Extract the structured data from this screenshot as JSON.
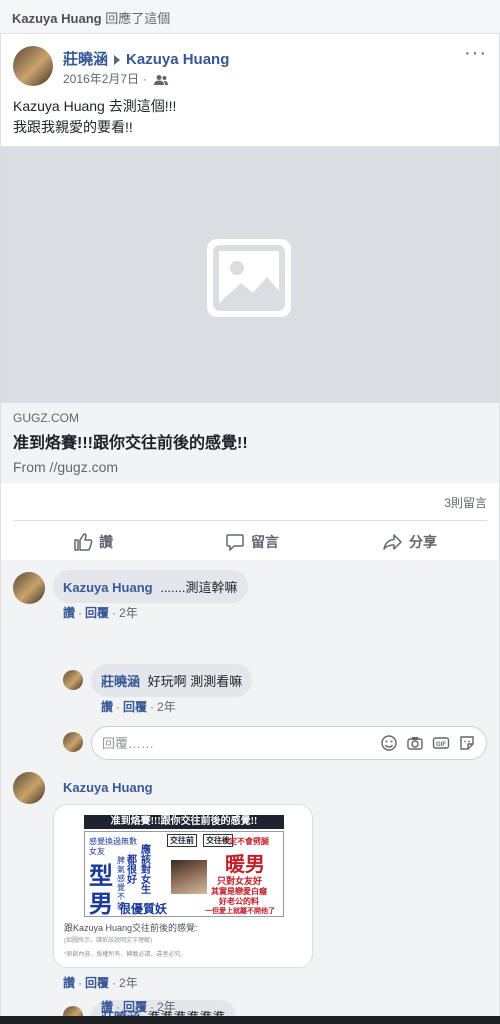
{
  "topbar": {
    "actor": "Kazuya Huang",
    "action": "回應了這個"
  },
  "post": {
    "author": "莊曉涵",
    "target": "Kazuya Huang",
    "date": "2016年2月7日",
    "text_line1": "Kazuya Huang 去測這個!!!",
    "text_line2": "我跟我親愛的要看!!",
    "link": {
      "domain": "GUGZ.COM",
      "title": "准到烙賽!!!跟你交往前後的感覺!!",
      "from": "From //gugz.com"
    },
    "comment_count": "3則留言",
    "actions": {
      "like": "讚",
      "comment": "留言",
      "share": "分享"
    }
  },
  "comments": [
    {
      "author": "Kazuya Huang",
      "text": ".......測這幹嘛",
      "like": "讚",
      "reply": "回覆",
      "time": "2年",
      "replies": [
        {
          "author": "莊曉涵",
          "text": "好玩啊 測測看嘛",
          "like": "讚",
          "reply": "回覆",
          "time": "2年"
        }
      ]
    },
    {
      "author": "Kazuya Huang",
      "like": "讚",
      "reply": "回覆",
      "time": "2年",
      "image": {
        "headline": "准到烙賽!!!跟你交往前後的感覺!!",
        "left_big_1": "型",
        "left_big_2": "男",
        "left_small_1": "感覺換過無數",
        "left_small_2": "女友",
        "left_small_3": "脾氣感覺不好",
        "left_mid_1": "都很好",
        "left_mid_2": "應該對女生",
        "left_bottom": "很優質妖",
        "tag_before": "交往前",
        "tag_after": "交往後",
        "right_top": "一定不會劈腿",
        "right_big": "暖男",
        "right_line1": "只對女友好",
        "right_line2": "其實是戀愛白癡",
        "right_line3": "好老公的料",
        "right_line4": "一但愛上就離不開他了",
        "caption": "跟Kazuya Huang交往前後的感覺:",
        "sub": "(如圖所示，請依該說明文字理解)",
        "foot": "*原創內容，版權所有，轉載必請，違者必究。"
      },
      "replies": [
        {
          "author": "莊曉涵",
          "text": "準準準準準準",
          "like": "讚",
          "reply": "回覆",
          "time": "2年"
        }
      ]
    }
  ],
  "reply_box": {
    "placeholder": "回覆……"
  }
}
